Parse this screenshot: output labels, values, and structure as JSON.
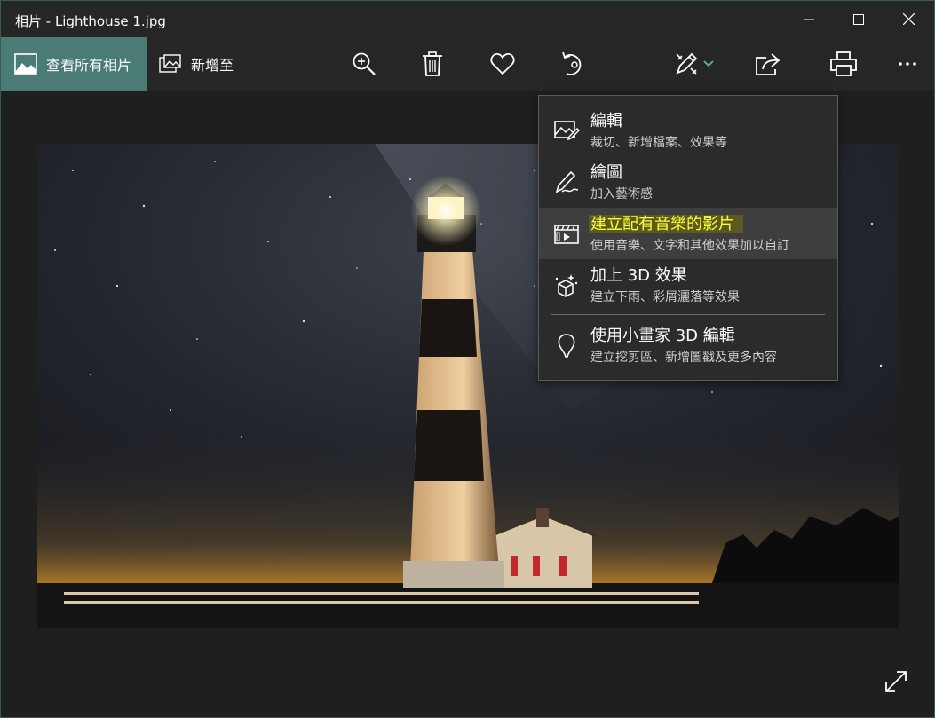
{
  "window": {
    "title": "相片 - Lighthouse 1.jpg"
  },
  "toolbar": {
    "view_all_label": "查看所有相片",
    "add_to_label": "新增至",
    "buttons": [
      "zoom-in-icon",
      "delete-icon",
      "favorite-icon",
      "rotate-icon",
      "edit-create-icon",
      "share-icon",
      "print-icon",
      "more-icon"
    ]
  },
  "menu": {
    "items": [
      {
        "title": "編輯",
        "subtitle": "裁切、新增檔案、效果等",
        "icon": "edit-image-icon"
      },
      {
        "title": "繪圖",
        "subtitle": "加入藝術感",
        "icon": "draw-pen-icon"
      },
      {
        "title": "建立配有音樂的影片",
        "subtitle": "使用音樂、文字和其他效果加以自訂",
        "icon": "video-film-icon",
        "highlighted": true
      },
      {
        "title": "加上 3D 效果",
        "subtitle": "建立下雨、彩屑灑落等效果",
        "icon": "3d-effects-icon"
      },
      {
        "title": "使用小畫家 3D 編輯",
        "subtitle": "建立挖剪區、新增圖戳及更多內容",
        "icon": "paint3d-icon"
      }
    ]
  },
  "colors": {
    "accent": "#4a7b74",
    "highlight_text": "#ffff33",
    "background": "#1f1f1f"
  }
}
